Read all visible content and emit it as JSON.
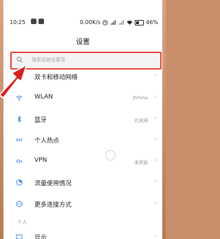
{
  "status_bar": {
    "time": "10:25",
    "speed": "0.00K/s",
    "battery": "46%"
  },
  "page": {
    "title": "设置"
  },
  "search": {
    "placeholder": "搜索系统设置项"
  },
  "items": [
    {
      "label": "双卡和移动网络",
      "value": ""
    },
    {
      "label": "WLAN",
      "value": "Jfchina"
    },
    {
      "label": "蓝牙",
      "value": "已关闭"
    },
    {
      "label": "个人热点",
      "value": ""
    },
    {
      "label": "VPN",
      "value": "未开启"
    },
    {
      "label": "流量使用情况",
      "value": ""
    },
    {
      "label": "更多连接方式",
      "value": ""
    }
  ],
  "section": {
    "label": "个人"
  },
  "partial_item": {
    "label": "显示"
  },
  "colors": {
    "highlight": "#e8403a",
    "accent_blue": "#3d84e6",
    "frame": "#c98f6a"
  }
}
